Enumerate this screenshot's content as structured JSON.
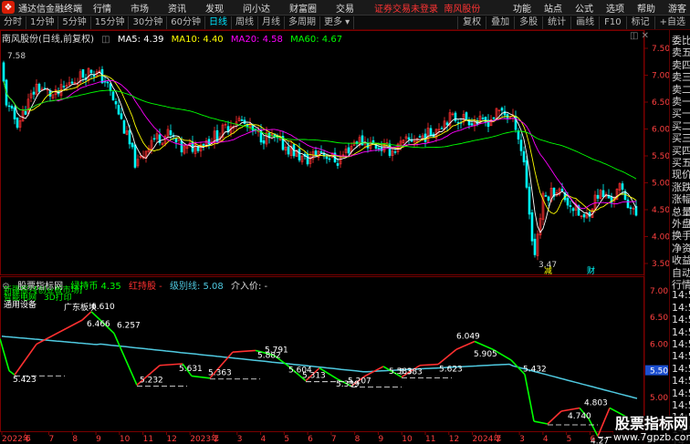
{
  "app": {
    "name": "通达信金融终端",
    "logo_glyph": "❖"
  },
  "menu": [
    "行情",
    "市场",
    "资讯",
    "发现",
    "问小达",
    "财富圈",
    "交易"
  ],
  "login_notice": "证券交易未登录",
  "stock_name_top": "南风股份",
  "right_menu": [
    "功能",
    "站点",
    "公式",
    "选项",
    "帮助",
    "游客"
  ],
  "periods": [
    "分时",
    "1分钟",
    "5分钟",
    "15分钟",
    "30分钟",
    "60分钟",
    "日线",
    "周线",
    "月线",
    "多周期",
    "更多 ▾"
  ],
  "active_period": "日线",
  "right_tools": [
    "复权",
    "叠加",
    "多股",
    "统计",
    "画线",
    "F10",
    "标记",
    "+自选"
  ],
  "price_header": {
    "stock": "南风股份(日线,前复权)",
    "ma5": "MA5: 4.39",
    "ma10": "MA10: 4.40",
    "ma20": "MA20: 4.58",
    "ma60": "MA60: 4.67"
  },
  "indicator_header": {
    "name": "股票指标网",
    "green_line": "绿持币 4.35",
    "red_line": "红持股 -",
    "level_line": "级别线: 5.08",
    "entry": "介入价: -"
  },
  "price_axis": [
    "7.50",
    "7.00",
    "6.50",
    "6.00",
    "5.50",
    "5.00",
    "4.50",
    "4.00",
    "3.50"
  ],
  "indicator_axis": [
    "7.00",
    "6.50",
    "6.00",
    "5.50",
    "5.00",
    "4.50"
  ],
  "indicator_axis_highlight": "5.50",
  "annotations_price": {
    "high": "7.58",
    "low": "3.47",
    "tag1": "减",
    "tag2": "财"
  },
  "sector_tags": [
    "新疆振兴",
    "国企改革",
    "一带一路"
  ],
  "sector_tags2": [
    "智能电网",
    "专用设备"
  ],
  "sector_tag3": "3D打印",
  "sector_tag4": "通用设备",
  "sector_tag5": "广东板块",
  "sector_tag6": "[创业板市场]",
  "indicator_labels": [
    "6.610",
    "6.466",
    "6.257",
    "5.423",
    "5.232",
    "5.631",
    "5.363",
    "5.882",
    "5.791",
    "5.604",
    "5.313",
    "5.339",
    "5.207",
    "5.583",
    "5.383",
    "5.623",
    "6.049",
    "5.905",
    "5.432",
    "4.740",
    "4.803",
    "4.27"
  ],
  "x_axis": [
    "2022年",
    "6",
    "7",
    "8",
    "9",
    "10",
    "11",
    "12",
    "2023年",
    "2",
    "3",
    "4",
    "5",
    "6",
    "7",
    "8",
    "9",
    "10",
    "11",
    "12",
    "2024年",
    "2",
    "3",
    "4",
    "5",
    "6",
    "7"
  ],
  "side_panel": [
    "委比",
    "卖五",
    "卖四",
    "卖三",
    "卖二",
    "卖一",
    "买一",
    "买二",
    "买三",
    "买四",
    "买五",
    "现价",
    "涨跌",
    "涨幅",
    "总量",
    "外盘",
    "换手",
    "净资",
    "收益",
    "自动",
    "行情",
    "14:5",
    "14:5",
    "14:5",
    "14:5",
    "14:5",
    "14:5",
    "14:5",
    "14:5",
    "14:5",
    "14:5",
    "14:5",
    "14:5",
    "14:5",
    "14:5"
  ],
  "watermark": {
    "line1": "股票指标网",
    "line2": "www.7gpzb.com"
  },
  "colors": {
    "ma5": "#ffffff",
    "ma10": "#ffff00",
    "ma20": "#ff00ff",
    "ma60": "#00ff00",
    "up": "#ff3030",
    "down": "#00ffff",
    "level": "#4fc9e0",
    "accent": "#d81e06"
  }
}
